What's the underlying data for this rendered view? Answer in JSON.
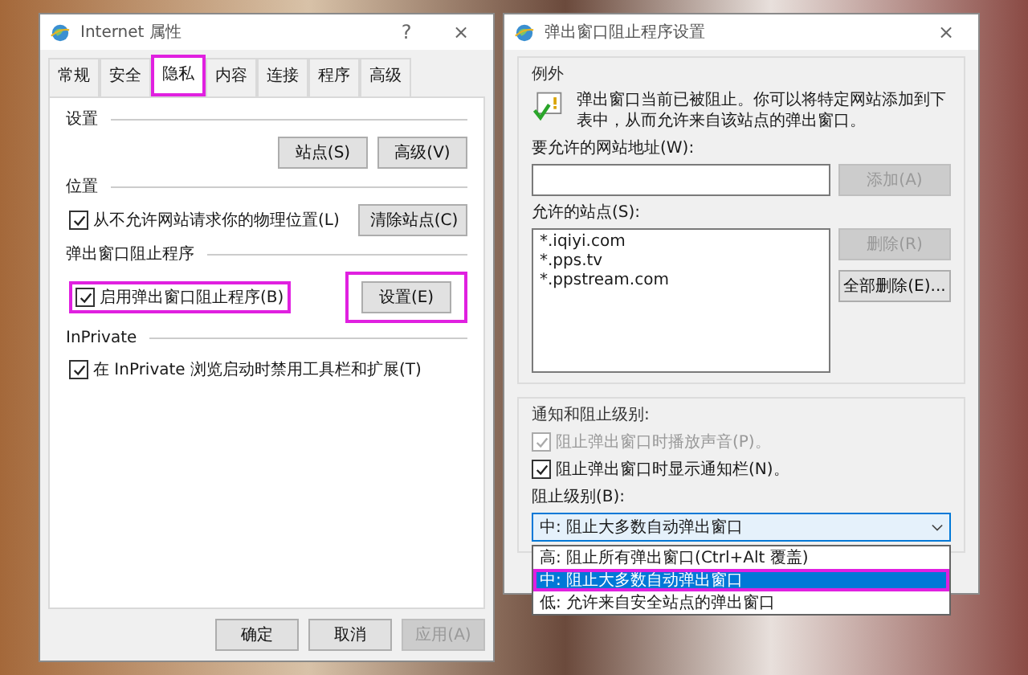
{
  "properties_window": {
    "title": "Internet 属性",
    "help": "?",
    "close": "×",
    "tabs": [
      {
        "label": "常规",
        "selected": false,
        "highlighted": false
      },
      {
        "label": "安全",
        "selected": false,
        "highlighted": false
      },
      {
        "label": "隐私",
        "selected": true,
        "highlighted": true
      },
      {
        "label": "内容",
        "selected": false,
        "highlighted": false
      },
      {
        "label": "连接",
        "selected": false,
        "highlighted": false
      },
      {
        "label": "程序",
        "selected": false,
        "highlighted": false
      },
      {
        "label": "高级",
        "selected": false,
        "highlighted": false
      }
    ],
    "sections": [
      {
        "title": "设置",
        "buttons": [
          {
            "label": "站点(S)",
            "highlighted": false
          },
          {
            "label": "高级(V)",
            "highlighted": false
          }
        ]
      },
      {
        "title": "位置",
        "checkbox": {
          "label": "从不允许网站请求你的物理位置(L)",
          "checked": true,
          "highlighted": false
        },
        "buttons": [
          {
            "label": "清除站点(C)",
            "highlighted": false
          }
        ]
      },
      {
        "title": "弹出窗口阻止程序",
        "checkbox": {
          "label": "启用弹出窗口阻止程序(B)",
          "checked": true,
          "highlighted": true
        },
        "buttons": [
          {
            "label": "设置(E)",
            "highlighted": true
          }
        ]
      },
      {
        "title": "InPrivate",
        "checkbox": {
          "label": "在 InPrivate 浏览启动时禁用工具栏和扩展(T)",
          "checked": true,
          "highlighted": false
        }
      }
    ],
    "footer_buttons": [
      {
        "label": "确定",
        "disabled": false
      },
      {
        "label": "取消",
        "disabled": false
      },
      {
        "label": "应用(A)",
        "disabled": true
      }
    ]
  },
  "popup_settings_window": {
    "title": "弹出窗口阻止程序设置",
    "close": "×",
    "exceptions": {
      "title": "例外",
      "info": "弹出窗口当前已被阻止。你可以将特定网站添加到下表中，从而允许来自该站点的弹出窗口。",
      "address_label": "要允许的网站地址(W):",
      "add_button": {
        "label": "添加(A)",
        "disabled": true
      },
      "list_label": "允许的站点(S):",
      "sites": [
        "*.iqiyi.com",
        "*.pps.tv",
        "*.ppstream.com"
      ],
      "remove_button": {
        "label": "删除(R)",
        "disabled": true
      },
      "remove_all_button": {
        "label": "全部删除(E)...",
        "disabled": false
      }
    },
    "notifications": {
      "title": "通知和阻止级别:",
      "checkboxes": [
        {
          "label": "阻止弹出窗口时播放声音(P)。",
          "checked": true,
          "disabled": true
        },
        {
          "label": "阻止弹出窗口时显示通知栏(N)。",
          "checked": true,
          "disabled": false
        }
      ],
      "level_label": "阻止级别(B):",
      "level_value": "中: 阻止大多数自动弹出窗口",
      "expanded": true,
      "options": [
        {
          "label": "高: 阻止所有弹出窗口(Ctrl+Alt 覆盖)",
          "selected": false,
          "highlighted": false
        },
        {
          "label": "中: 阻止大多数自动弹出窗口",
          "selected": true,
          "highlighted": true
        },
        {
          "label": "低: 允许来自安全站点的弹出窗口",
          "selected": false,
          "highlighted": false
        }
      ]
    }
  }
}
